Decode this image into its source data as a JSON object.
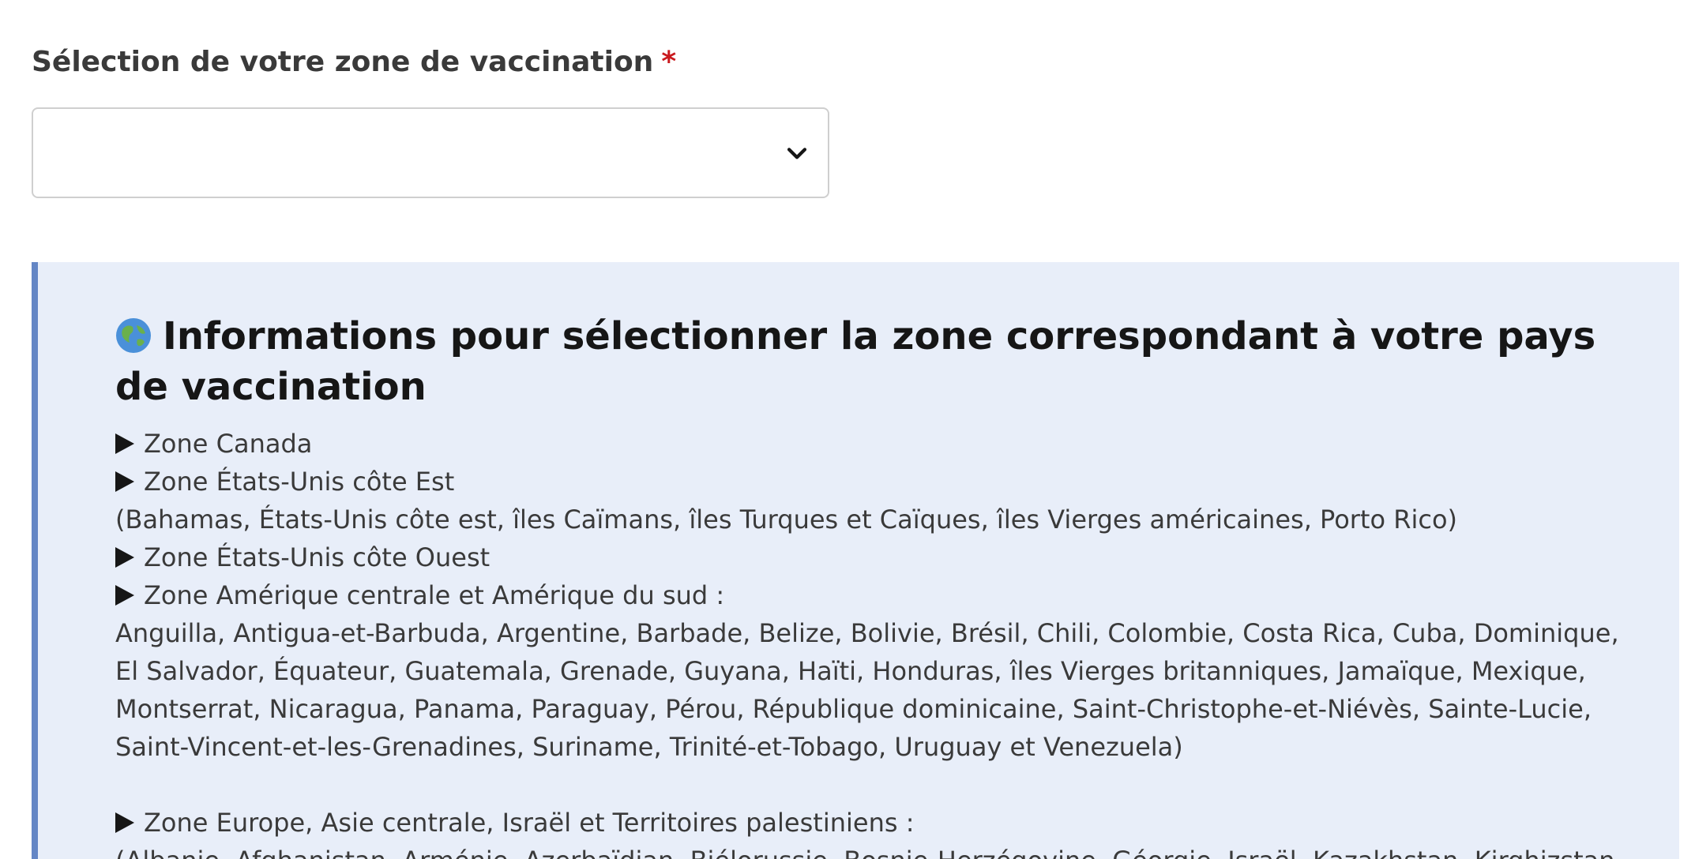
{
  "field": {
    "label": "Sélection de votre zone de vaccination",
    "required_marker": "*",
    "selected_value": ""
  },
  "info": {
    "icon": "globe-icon",
    "title": "Informations pour sélectionner la zone correspondant à votre pays de vaccination",
    "zones": [
      {
        "name": "Zone Canada",
        "details": ""
      },
      {
        "name": "Zone États-Unis côte Est",
        "details": "(Bahamas, États-Unis côte est, îles Caïmans, îles Turques et Caïques, îles Vierges américaines, Porto Rico)"
      },
      {
        "name": "Zone États-Unis côte Ouest",
        "details": ""
      },
      {
        "name": "Zone Amérique centrale et Amérique du sud :",
        "details": "Anguilla, Antigua-et-Barbuda, Argentine, Barbade, Belize, Bolivie, Brésil, Chili, Colombie, Costa Rica, Cuba, Dominique, El Salvador, Équateur, Guatemala, Grenade, Guyana, Haïti, Honduras, îles Vierges britanniques, Jamaïque, Mexique, Montserrat, Nicaragua, Panama, Paraguay, Pérou, République dominicaine, Saint-Christophe-et-Niévès, Sainte-Lucie, Saint-Vincent-et-les-Grenadines, Suriname, Trinité-et-Tobago, Uruguay et Venezuela)"
      },
      {
        "name": "Zone Europe, Asie centrale, Israël et Territoires palestiniens :",
        "details": "(Albanie, Afghanistan, Arménie, Azerbaïdjan, Biélorussie, Bosnie-Herzégovine, Géorgie, Israël, Kazakhstan, Kirghizstan"
      }
    ]
  },
  "colors": {
    "info_background": "#e8eef9",
    "info_border": "#6486c5",
    "required": "#c9191e"
  }
}
